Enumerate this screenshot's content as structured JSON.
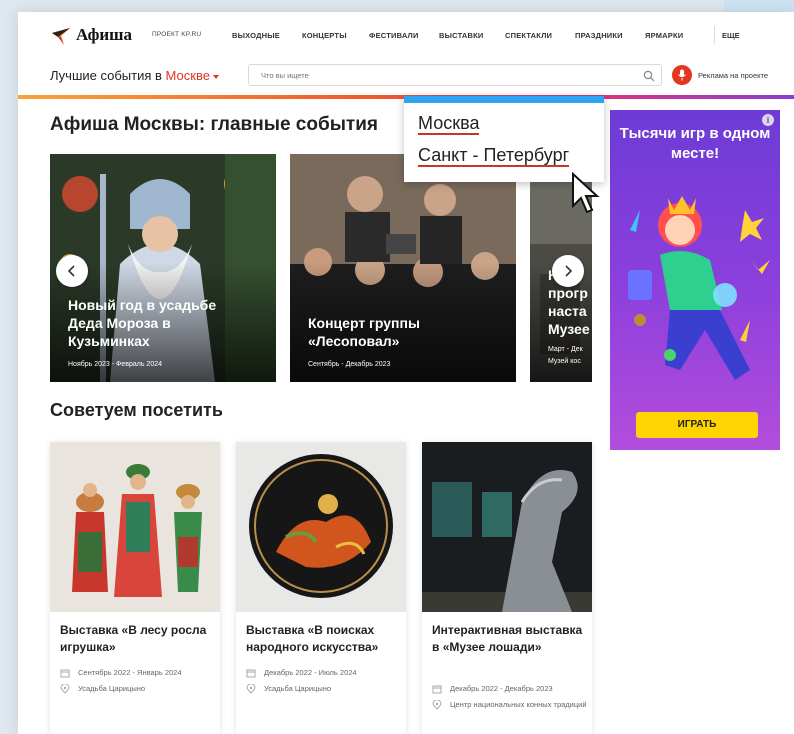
{
  "colors": {
    "brand_red": "#e4351f",
    "dropdown_accent": "#2ea3f2",
    "ad_purple": "#7a3ed8",
    "ad_button": "#ffd400"
  },
  "header": {
    "logo_text": "Афиша",
    "logo_sub": "ПРОЕКТ KP.RU",
    "nav": [
      "ВЫХОДНЫЕ",
      "КОНЦЕРТЫ",
      "ФЕСТИВАЛИ",
      "ВЫСТАВКИ",
      "СПЕКТАКЛИ",
      "ПРАЗДНИКИ",
      "ЯРМАРКИ"
    ],
    "nav_more": "ЕЩЕ"
  },
  "search": {
    "prefix": "Лучшие события в",
    "city": "Москве",
    "placeholder": "Что вы ищете",
    "ad_link": "Реклама на проекте"
  },
  "main": {
    "title": "Афиша Москвы: главные события",
    "carousel": [
      {
        "title_lines": [
          "Новый год в усадьбе",
          "Деда Мороза в",
          "Кузьминках"
        ],
        "date": "Ноябрь 2023 - Февраль 2024"
      },
      {
        "title_lines": [
          "Концерт группы",
          "«Лесоповал»"
        ],
        "date": "Сентябрь - Декабрь 2023"
      },
      {
        "title_lines": [
          "Н",
          "прогр",
          "наста",
          "Музее"
        ],
        "date": "Март - Дек",
        "date2": "Музей кос"
      }
    ],
    "recommend_title": "Советуем посетить",
    "recommend": [
      {
        "title": "Выставка «В лесу росла игрушка»",
        "date": "Сентябрь 2022 - Январь 2024",
        "place": "Усадьба Царицыно"
      },
      {
        "title": "Выставка «В поисках народного искусства»",
        "date": "Декабрь 2022 - Июль 2024",
        "place": "Усадьба Царицыно"
      },
      {
        "title": "Интерактивная выставка в «Музее лошади»",
        "date": "Декабрь 2022 - Декабрь 2023",
        "place": "Центр национальных конных традиций"
      }
    ]
  },
  "ad": {
    "headline": "Тысячи игр в одном месте!",
    "button": "ИГРАТЬ",
    "info": "i"
  },
  "dropdown": {
    "options": [
      "Москва",
      "Санкт - Петербург"
    ]
  }
}
